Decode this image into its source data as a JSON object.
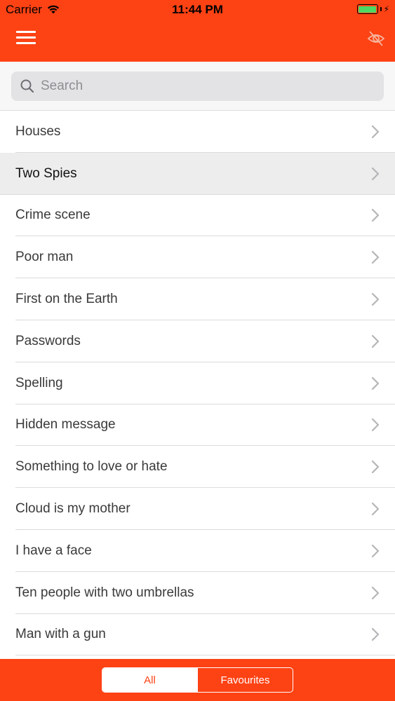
{
  "status_bar": {
    "carrier": "Carrier",
    "time": "11:44 PM",
    "battery_color": "#4cd964"
  },
  "header": {
    "menu_icon": "hamburger-menu-icon",
    "visibility_icon": "eye-slash-icon",
    "background_color": "#fd4214"
  },
  "search": {
    "placeholder": "Search",
    "value": ""
  },
  "list": {
    "items": [
      {
        "label": "Houses",
        "selected": false
      },
      {
        "label": "Two Spies",
        "selected": true
      },
      {
        "label": "Crime scene",
        "selected": false
      },
      {
        "label": "Poor man",
        "selected": false
      },
      {
        "label": "First on the Earth",
        "selected": false
      },
      {
        "label": "Passwords",
        "selected": false
      },
      {
        "label": "Spelling",
        "selected": false
      },
      {
        "label": "Hidden message",
        "selected": false
      },
      {
        "label": "Something to love or hate",
        "selected": false
      },
      {
        "label": "Cloud is my mother",
        "selected": false
      },
      {
        "label": "I have a face",
        "selected": false
      },
      {
        "label": "Ten people with two umbrellas",
        "selected": false
      },
      {
        "label": "Man with a gun",
        "selected": false
      }
    ]
  },
  "tabs": {
    "all_label": "All",
    "favourites_label": "Favourites",
    "active": "All"
  }
}
